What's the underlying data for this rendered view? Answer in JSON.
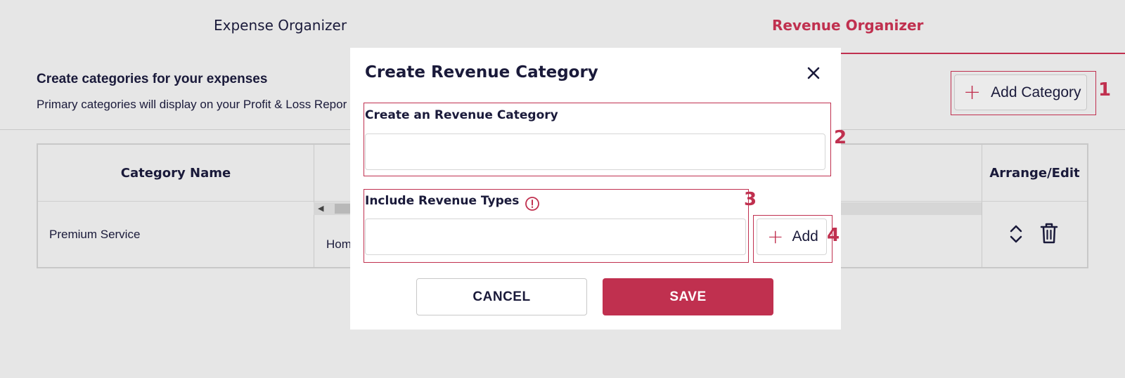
{
  "tabs": [
    {
      "label": "Expense Organizer",
      "active": false
    },
    {
      "label": "Revenue Organizer",
      "active": true
    }
  ],
  "section": {
    "title": "Create categories for your expenses",
    "subtitle": "Primary categories will display on your Profit & Loss Repor"
  },
  "add_category_button": {
    "label": "Add Category"
  },
  "annotations": [
    "1",
    "2",
    "3",
    "4"
  ],
  "table": {
    "headers": [
      "Category Name",
      "Arrange/Edit"
    ],
    "rows": [
      {
        "name": "Premium Service",
        "types": "Hom"
      }
    ]
  },
  "modal": {
    "title": "Create Revenue Category",
    "category_label": "Create an Revenue Category",
    "category_value": "",
    "types_label": "Include Revenue Types",
    "types_value": "",
    "add_label": "Add",
    "cancel_label": "CANCEL",
    "save_label": "SAVE"
  },
  "icons": {
    "close": "close-icon",
    "info": "info-icon",
    "plus": "plus-icon",
    "sort": "sort-arrows-icon",
    "trash": "trash-icon"
  },
  "colors": {
    "accent": "#c0304f",
    "text": "#1a1a3a",
    "background": "#e6e6e6"
  }
}
